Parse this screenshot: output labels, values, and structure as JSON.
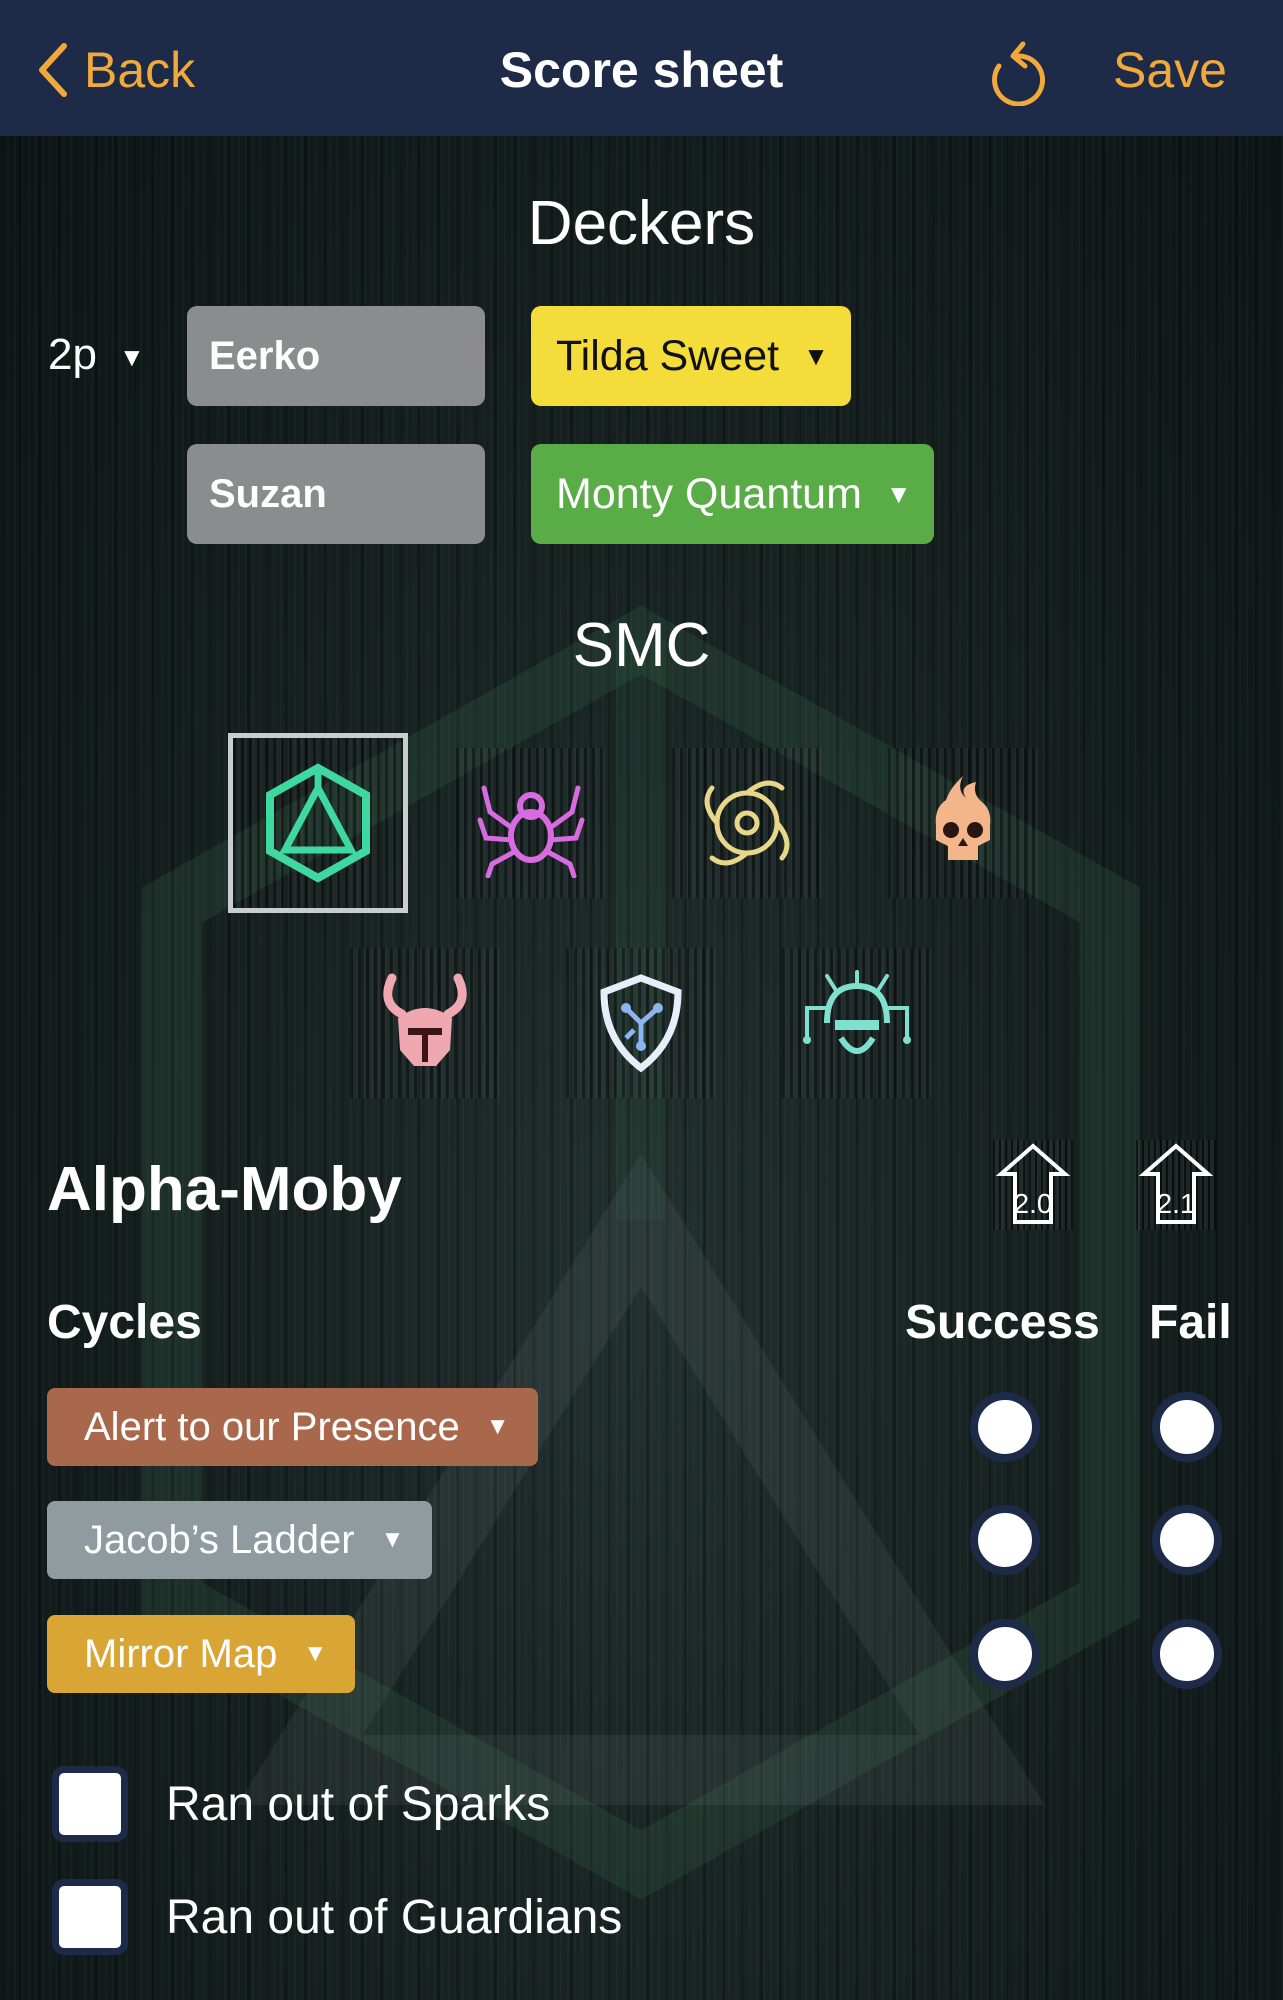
{
  "header": {
    "back_label": "Back",
    "title": "Score sheet",
    "save_label": "Save",
    "accent_color": "#f2a93b",
    "bar_color": "#1d2b49",
    "undo_icon": "undo-icon"
  },
  "deckers": {
    "heading": "Deckers",
    "player_count": "2p",
    "players": [
      {
        "name": "Eerko",
        "runner": "Tilda Sweet",
        "runner_color": "#f4dc3a",
        "runner_text_color": "#111111"
      },
      {
        "name": "Suzan",
        "runner": "Monty Quantum",
        "runner_color": "#5aac46",
        "runner_text_color": "#ffffff"
      }
    ]
  },
  "smc": {
    "heading": "SMC",
    "icons": [
      {
        "name": "alpha-moby-icon",
        "color": "#3fd8a0",
        "selected": true
      },
      {
        "name": "spider-icon",
        "color": "#d86be0",
        "selected": false
      },
      {
        "name": "vortex-icon",
        "color": "#e8d78a",
        "selected": false
      },
      {
        "name": "flaming-skull-icon",
        "color": "#f2b68a",
        "selected": false
      },
      {
        "name": "horned-helmet-icon",
        "color": "#f0a8b0",
        "selected": false
      },
      {
        "name": "circuit-shield-icon",
        "color": "#8cb4f0",
        "selected": false
      },
      {
        "name": "circuit-face-icon",
        "color": "#7fe0d0",
        "selected": false
      }
    ]
  },
  "boss": {
    "name": "Alpha-Moby",
    "versions": [
      "2.0",
      "2.1"
    ]
  },
  "cycles": {
    "heading": "Cycles",
    "success_label": "Success",
    "fail_label": "Fail",
    "items": [
      {
        "label": "Alert to our Presence",
        "color": "#a9684b"
      },
      {
        "label": "Jacob’s Ladder",
        "color": "#8f9b9e"
      },
      {
        "label": "Mirror Map",
        "color": "#d9a534"
      }
    ]
  },
  "checks": [
    {
      "label": "Ran out of Sparks",
      "checked": false
    },
    {
      "label": "Ran out of Guardians",
      "checked": false
    }
  ]
}
